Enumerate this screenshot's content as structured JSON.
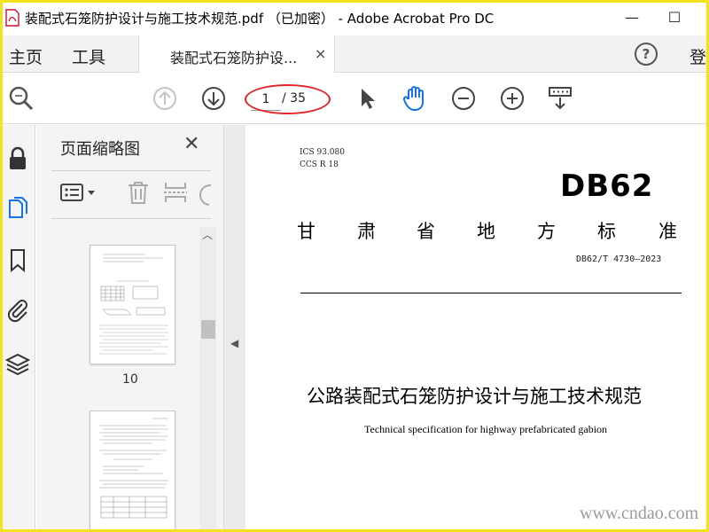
{
  "window": {
    "title": "装配式石笼防护设计与施工技术规范.pdf （已加密） - Adobe Acrobat Pro DC",
    "minimize": "—",
    "maximize": "☐"
  },
  "tabs": {
    "home": "主页",
    "tools": "工具",
    "document": "装配式石笼防护设...",
    "document_close": "×",
    "help": "?",
    "login": "登"
  },
  "toolbar": {
    "current_page": "1",
    "total_pages": "/ 35",
    "icons": [
      "search-icon",
      "previous-page-icon",
      "next-page-icon",
      "select-pointer-icon",
      "hand-tool-icon",
      "zoom-out-icon",
      "zoom-in-icon",
      "page-display-icon"
    ]
  },
  "rail": {
    "icons": [
      "lock-icon",
      "page-thumbnails-icon",
      "bookmark-icon",
      "attachment-icon",
      "layers-icon"
    ]
  },
  "thumbnails_panel": {
    "title": "页面缩略图",
    "close": "✕",
    "thumbnails": [
      {
        "page_label": "10"
      }
    ]
  },
  "document": {
    "ics": "ICS  93.080",
    "ccs": "CCS  R 18",
    "logo": "DB62",
    "province_chars": [
      "甘",
      "肃",
      "省",
      "地",
      "方",
      "标",
      "准"
    ],
    "standard_number": "DB62/T 4730—2023",
    "title_cn": "公路装配式石笼防护设计与施工技术规范",
    "title_en": "Technical specification for highway prefabricated gabion"
  },
  "watermark": "www.cndao.com",
  "colors": {
    "frame": "#f2e31a",
    "annotation_ellipse": "#e0252a",
    "hand_tool_active": "#1473e6",
    "rail_active": "#1473e6"
  }
}
